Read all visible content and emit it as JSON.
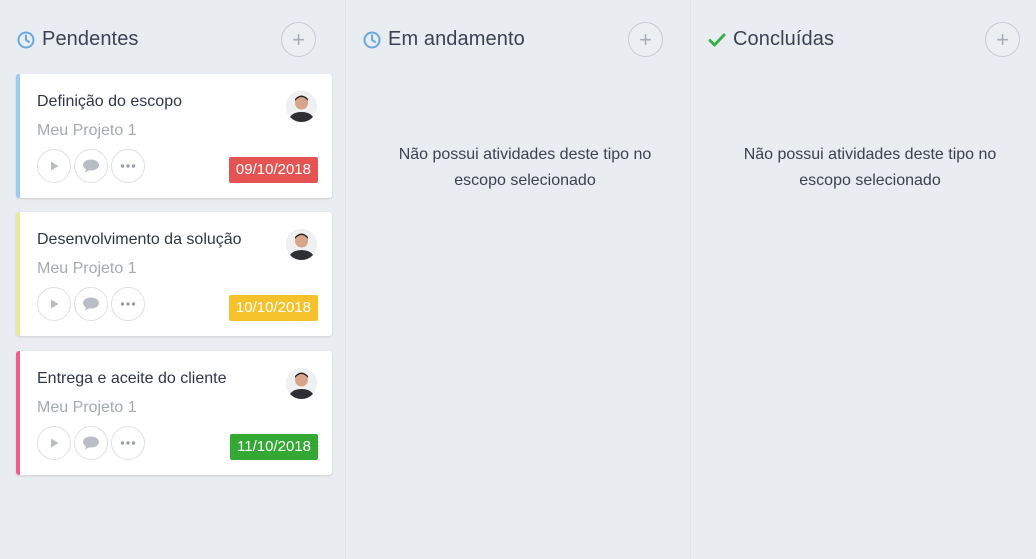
{
  "columns": [
    {
      "title": "Pendentes",
      "icon": "clock-icon",
      "icon_color": "#6aa8e0",
      "add_label": "+",
      "cards": [
        {
          "title": "Definição do escopo",
          "project": "Meu Projeto 1",
          "date": "09/10/2018",
          "date_color": "#e55353",
          "accent": "#9ccbf0"
        },
        {
          "title": "Desenvolvimento da solução",
          "project": "Meu Projeto 1",
          "date": "10/10/2018",
          "date_color": "#f6c22b",
          "accent": "#e8ea9a"
        },
        {
          "title": "Entrega e aceite do cliente",
          "project": "Meu Projeto 1",
          "date": "11/10/2018",
          "date_color": "#33a933",
          "accent": "#f25e8c"
        }
      ]
    },
    {
      "title": "Em andamento",
      "icon": "clock-icon",
      "icon_color": "#6aa8e0",
      "add_label": "+",
      "empty_line1": "Não possui atividades deste tipo no",
      "empty_line2": "escopo selecionado"
    },
    {
      "title": "Concluídas",
      "icon": "check-icon",
      "icon_color": "#35b24a",
      "add_label": "+",
      "empty_line1": "Não possui atividades deste tipo no",
      "empty_line2": "escopo selecionado"
    }
  ]
}
